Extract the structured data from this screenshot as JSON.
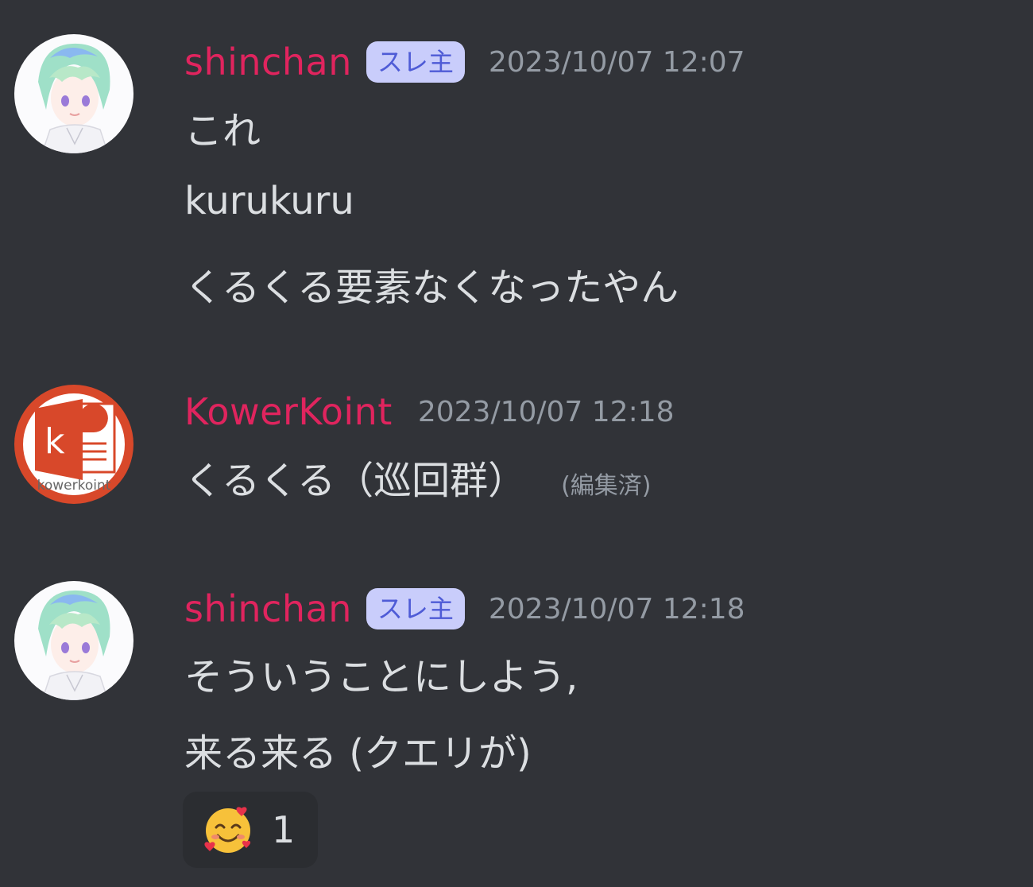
{
  "messages": [
    {
      "username": "shinchan",
      "tag": "スレ主",
      "timestamp": "2023/10/07 12:07",
      "avatar": "anime-girl-avatar-icon",
      "lines": [
        "これ",
        "kurukuru",
        "くるくる要素なくなったやん"
      ]
    },
    {
      "username": "KowerKoint",
      "timestamp": "2023/10/07 12:18",
      "avatar": "kowerkoint-logo-avatar-icon",
      "avatar_logo_letter": "k",
      "avatar_logo_text": "kowerkoint",
      "lines": [
        "くるくる（巡回群）"
      ],
      "edited": "(編集済)"
    },
    {
      "username": "shinchan",
      "tag": "スレ主",
      "timestamp": "2023/10/07 12:18",
      "avatar": "anime-girl-avatar-icon",
      "lines": [
        "そういうことにしよう,",
        "来る来る (クエリが)"
      ],
      "reaction": {
        "emoji": "smiling-face-with-hearts-icon",
        "count": "1"
      }
    }
  ],
  "colors": {
    "background": "#313338",
    "username": "#e0245e",
    "tag_bg": "#c9cdfb",
    "tag_text": "#4e5bd6",
    "timestamp": "#949ba4",
    "message_text": "#dbdee1",
    "reaction_bg": "#2b2d31"
  }
}
